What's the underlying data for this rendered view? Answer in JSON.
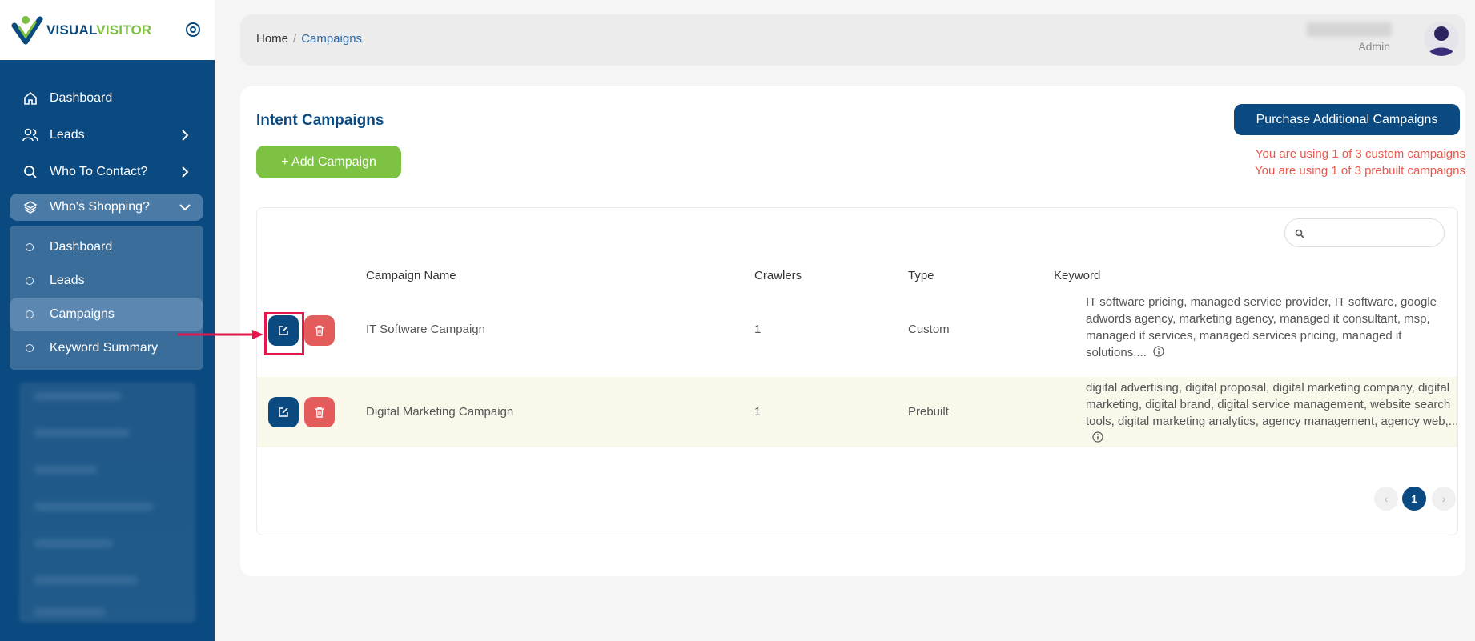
{
  "brand": {
    "part1": "VISUAL",
    "part2": "VISITOR"
  },
  "sidebar": {
    "items": [
      {
        "label": "Dashboard",
        "icon": "home-icon"
      },
      {
        "label": "Leads",
        "icon": "users-icon"
      },
      {
        "label": "Who To Contact?",
        "icon": "search-icon"
      },
      {
        "label": "Who's Shopping?",
        "icon": "layers-icon"
      }
    ],
    "submenu": [
      {
        "label": "Dashboard"
      },
      {
        "label": "Leads"
      },
      {
        "label": "Campaigns"
      },
      {
        "label": "Keyword Summary"
      }
    ]
  },
  "header": {
    "breadcrumb": {
      "home": "Home",
      "sep": "/",
      "current": "Campaigns"
    },
    "user_role": "Admin"
  },
  "main": {
    "title": "Intent Campaigns",
    "add_button": "+ Add Campaign",
    "purchase_button": "Purchase Additional Campaigns",
    "usage_custom": "You are using 1 of 3 custom campaigns",
    "usage_prebuilt": "You are using 1 of 3 prebuilt campaigns",
    "search_placeholder": "",
    "columns": [
      "Campaign Name",
      "Crawlers",
      "Type",
      "Keyword"
    ],
    "rows": [
      {
        "name": "IT Software Campaign",
        "crawlers": "1",
        "type": "Custom",
        "keywords": "IT software pricing, managed service provider, IT software, google adwords agency, marketing agency, managed it consultant, msp, managed it services, managed services pricing, managed it solutions,..."
      },
      {
        "name": "Digital Marketing Campaign",
        "crawlers": "1",
        "type": "Prebuilt",
        "keywords": "digital advertising, digital proposal, digital marketing company, digital marketing, digital brand, digital service management, website search tools, digital marketing analytics, agency management, agency web,..."
      }
    ],
    "pagination": {
      "prev": "‹",
      "current": "1",
      "next": "›"
    }
  },
  "colors": {
    "primary": "#0b4a80",
    "accent_green": "#7dc243",
    "danger": "#e35b5b",
    "highlight": "#e5174d"
  }
}
